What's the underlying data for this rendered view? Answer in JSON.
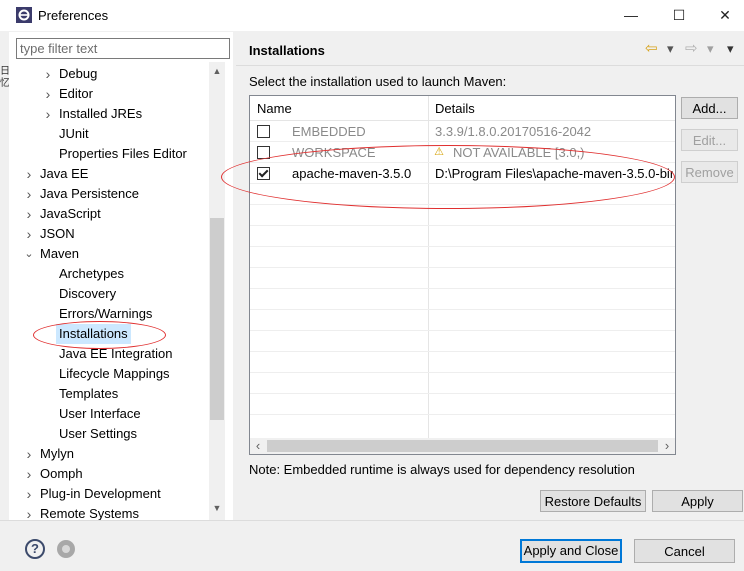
{
  "window": {
    "title": "Preferences",
    "minimize_glyph": "—",
    "maximize_glyph": "☐",
    "close_glyph": "✕"
  },
  "left_edge_text": "日\n忆",
  "filter": {
    "placeholder": "type filter text",
    "value": ""
  },
  "tree": [
    {
      "label": "Debug",
      "level": 1,
      "expander": "collapsed"
    },
    {
      "label": "Editor",
      "level": 1,
      "expander": "collapsed"
    },
    {
      "label": "Installed JREs",
      "level": 1,
      "expander": "collapsed"
    },
    {
      "label": "JUnit",
      "level": 1,
      "expander": "none"
    },
    {
      "label": "Properties Files Editor",
      "level": 1,
      "expander": "none"
    },
    {
      "label": "Java EE",
      "level": 0,
      "expander": "collapsed"
    },
    {
      "label": "Java Persistence",
      "level": 0,
      "expander": "collapsed"
    },
    {
      "label": "JavaScript",
      "level": 0,
      "expander": "collapsed"
    },
    {
      "label": "JSON",
      "level": 0,
      "expander": "collapsed"
    },
    {
      "label": "Maven",
      "level": 0,
      "expander": "expanded"
    },
    {
      "label": "Archetypes",
      "level": 1,
      "expander": "none"
    },
    {
      "label": "Discovery",
      "level": 1,
      "expander": "none"
    },
    {
      "label": "Errors/Warnings",
      "level": 1,
      "expander": "none"
    },
    {
      "label": "Installations",
      "level": 1,
      "expander": "none",
      "selected": true
    },
    {
      "label": "Java EE Integration",
      "level": 1,
      "expander": "none"
    },
    {
      "label": "Lifecycle Mappings",
      "level": 1,
      "expander": "none"
    },
    {
      "label": "Templates",
      "level": 1,
      "expander": "none"
    },
    {
      "label": "User Interface",
      "level": 1,
      "expander": "none"
    },
    {
      "label": "User Settings",
      "level": 1,
      "expander": "none"
    },
    {
      "label": "Mylyn",
      "level": 0,
      "expander": "collapsed"
    },
    {
      "label": "Oomph",
      "level": 0,
      "expander": "collapsed"
    },
    {
      "label": "Plug-in Development",
      "level": 0,
      "expander": "collapsed"
    },
    {
      "label": "Remote Systems",
      "level": 0,
      "expander": "collapsed"
    }
  ],
  "page": {
    "title": "Installations",
    "prompt": "Select the installation used to launch Maven:",
    "note": "Note: Embedded runtime is always used for dependency resolution"
  },
  "table": {
    "columns": [
      "Name",
      "Details"
    ],
    "rows": [
      {
        "name": "EMBEDDED",
        "details": "3.3.9/1.8.0.20170516-2042",
        "checked": false,
        "dim": true,
        "warning": false
      },
      {
        "name": "WORKSPACE",
        "details": "NOT AVAILABLE [3.0,)",
        "checked": false,
        "dim": true,
        "warning": true
      },
      {
        "name": "apache-maven-3.5.0",
        "details": "D:\\Program Files\\apache-maven-3.5.0-bin",
        "checked": true,
        "dim": false,
        "warning": false
      }
    ],
    "empty_rows": 11
  },
  "buttons": {
    "add": "Add...",
    "edit": "Edit...",
    "remove": "Remove",
    "restore_defaults": "Restore Defaults",
    "apply": "Apply",
    "apply_and_close": "Apply and Close",
    "cancel": "Cancel"
  },
  "icons": {
    "back": "⇦",
    "forward": "⇨",
    "dropdown": "▾",
    "view_menu": "▾",
    "help": "?",
    "tree_collapsed": "›",
    "tree_expanded": "⌄",
    "scroll_up": "▲",
    "scroll_down": "▼",
    "scroll_left": "‹",
    "scroll_right": "›"
  },
  "colors": {
    "selection": "#cce8ff",
    "default_button_border": "#0078d7",
    "annotation": "#e03030",
    "warning": "#d4a000"
  }
}
